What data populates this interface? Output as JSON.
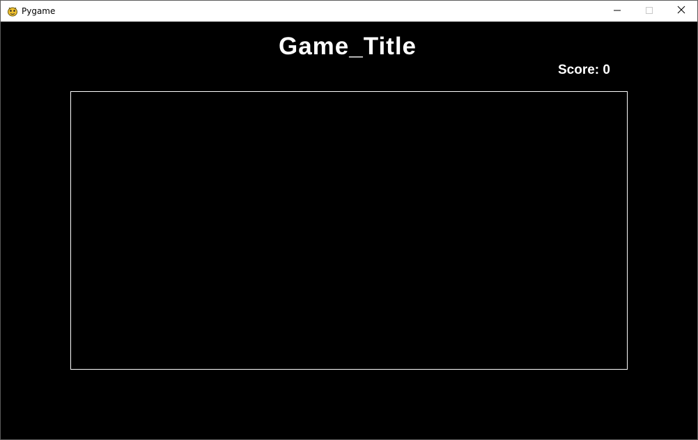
{
  "window": {
    "title": "Pygame",
    "app_icon": "pygame-snake-icon",
    "controls": {
      "minimize_icon": "minimize-icon",
      "maximize_icon": "maximize-icon",
      "close_icon": "close-icon"
    }
  },
  "game": {
    "title": "Game_Title",
    "score_text": "Score: 0",
    "background_color": "#000000",
    "text_color": "#ffffff",
    "field_border_color": "#ffffff"
  }
}
